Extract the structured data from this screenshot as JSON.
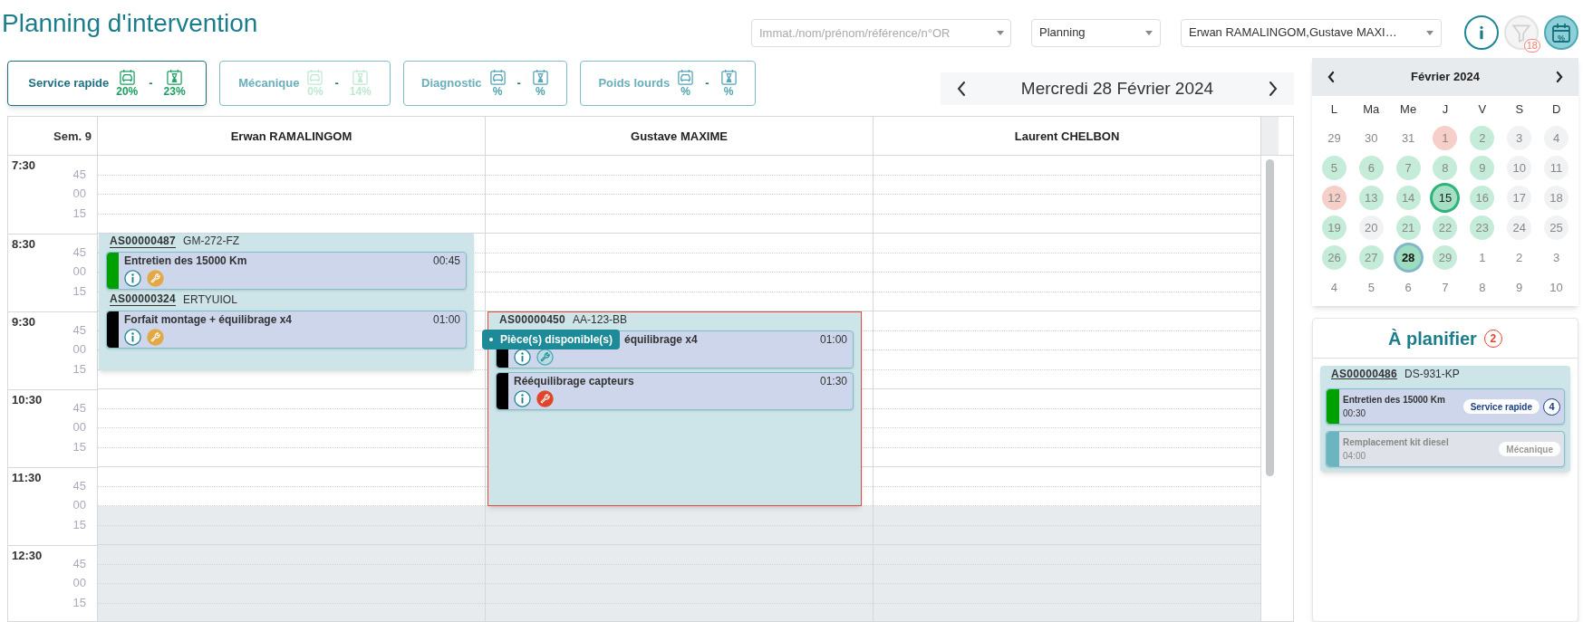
{
  "title": "Planning d'intervention",
  "toolbar": {
    "search": {
      "placeholder": "Immat./nom/prénom/référence/n°OR"
    },
    "view_select": {
      "value": "Planning"
    },
    "technicians_select": {
      "value": "Erwan RAMALINGOM,Gustave MAXI…"
    },
    "buttons": [
      {
        "kind": "info",
        "selected": false,
        "disabled": false
      },
      {
        "kind": "filter",
        "selected": false,
        "disabled": true,
        "badge": "18"
      },
      {
        "kind": "calendar",
        "selected": true,
        "disabled": false,
        "label": "%"
      }
    ]
  },
  "categories": [
    {
      "label": "Service rapide",
      "selected": true,
      "color": "#1aa060",
      "separator": "-",
      "stats": [
        "20%",
        "23%"
      ]
    },
    {
      "label": "Mécanique",
      "selected": false,
      "color": "#bfe8d2",
      "separator": "-",
      "stats": [
        "0%",
        "14%"
      ]
    },
    {
      "label": "Diagnostic",
      "selected": false,
      "color": "#4fa3b2",
      "separator": "-",
      "stats": [
        "%",
        "%"
      ]
    },
    {
      "label": "Poids lourds",
      "selected": false,
      "color": "#4fa3b2",
      "separator": "-",
      "stats": [
        "%",
        "%"
      ]
    }
  ],
  "date_nav": {
    "date": "Mercredi 28 Février 2024"
  },
  "planning": {
    "week_label": "Sem. 9",
    "rows": [
      {
        "label": "7:30",
        "kind": "hour",
        "closed": false
      },
      {
        "label": "45",
        "kind": "quarter",
        "closed": false
      },
      {
        "label": "00",
        "kind": "quarter",
        "closed": false
      },
      {
        "label": "15",
        "kind": "quarter",
        "closed": false
      },
      {
        "label": "8:30",
        "kind": "hour",
        "closed": false
      },
      {
        "label": "45",
        "kind": "quarter",
        "closed": false
      },
      {
        "label": "00",
        "kind": "quarter",
        "closed": false
      },
      {
        "label": "15",
        "kind": "quarter",
        "closed": false
      },
      {
        "label": "9:30",
        "kind": "hour",
        "closed": false
      },
      {
        "label": "45",
        "kind": "quarter",
        "closed": false
      },
      {
        "label": "00",
        "kind": "quarter",
        "closed": false
      },
      {
        "label": "15",
        "kind": "quarter",
        "closed": false
      },
      {
        "label": "10:30",
        "kind": "hour",
        "closed": false
      },
      {
        "label": "45",
        "kind": "quarter",
        "closed": false
      },
      {
        "label": "00",
        "kind": "quarter",
        "closed": false
      },
      {
        "label": "15",
        "kind": "quarter",
        "closed": false
      },
      {
        "label": "11:30",
        "kind": "hour",
        "closed": false
      },
      {
        "label": "45",
        "kind": "quarter",
        "closed": false
      },
      {
        "label": "00",
        "kind": "quarter",
        "closed": true
      },
      {
        "label": "15",
        "kind": "quarter",
        "closed": true
      },
      {
        "label": "12:30",
        "kind": "hour",
        "closed": true
      },
      {
        "label": "45",
        "kind": "quarter",
        "closed": true
      },
      {
        "label": "00",
        "kind": "quarter",
        "closed": true
      },
      {
        "label": "15",
        "kind": "quarter",
        "closed": true
      }
    ],
    "columns": [
      {
        "name": "Erwan RAMALINGOM",
        "timeline": [
          {
            "kind": "free"
          },
          {
            "kind": "free"
          },
          {
            "kind": "free"
          },
          {
            "kind": "free"
          },
          {
            "kind": "booking",
            "ref": "AS00000487",
            "underlined": true,
            "plate": "GM-272-FZ",
            "alert": false,
            "tasks": [
              {
                "title": "Entretien des 15000 Km",
                "duration": "00:45",
                "color": "#00a000",
                "parts_available": false,
                "parts_missing": false
              }
            ]
          },
          {
            "kind": "booking",
            "ref": "AS00000324",
            "underlined": true,
            "plate": "ERTYUIOL",
            "alert": false,
            "tasks": [
              {
                "title": "Forfait montage + équilibrage x4",
                "duration": "01:00",
                "color": "#000000",
                "parts_available": false,
                "parts_missing": false
              }
            ]
          }
        ]
      },
      {
        "name": "Gustave MAXIME",
        "timeline": [
          {
            "kind": "free"
          },
          {
            "kind": "free"
          },
          {
            "kind": "free"
          },
          {
            "kind": "free"
          },
          {
            "kind": "free"
          },
          {
            "kind": "free"
          },
          {
            "kind": "free"
          },
          {
            "kind": "free"
          },
          {
            "kind": "booking",
            "ref": "AS00000450",
            "underlined": false,
            "plate": "AA-123-BB",
            "alert": true,
            "tasks": [
              {
                "title": "équilibrage x4",
                "duration": "01:00",
                "color": "#000000",
                "parts_available": true,
                "parts_missing": false,
                "tooltip": "Pièce(s) disponible(s)"
              },
              {
                "title": "Rééquilibrage capteurs",
                "duration": "01:30",
                "color": "#000000",
                "parts_available": false,
                "parts_missing": true
              }
            ]
          }
        ]
      },
      {
        "name": "Laurent CHELBON"
      }
    ]
  },
  "mini_calendar": {
    "month": "Février 2024",
    "weekdays": [
      "L",
      "Ma",
      "Me",
      "J",
      "V",
      "S",
      "D"
    ],
    "days": [
      {
        "label": "29",
        "selected": false,
        "ringed": false
      },
      {
        "label": "30",
        "selected": false,
        "ringed": false
      },
      {
        "label": "31",
        "selected": false,
        "ringed": false
      },
      {
        "label": "1",
        "color": "#f6cfc9",
        "selected": false,
        "ringed": false
      },
      {
        "label": "2",
        "color": "#c5ecd9",
        "selected": false,
        "ringed": false
      },
      {
        "label": "3",
        "color": "#f1f2f4",
        "selected": false,
        "ringed": false
      },
      {
        "label": "4",
        "color": "#f1f2f4",
        "selected": false,
        "ringed": false
      },
      {
        "label": "5",
        "color": "#c5ecd9",
        "selected": false,
        "ringed": false
      },
      {
        "label": "6",
        "color": "#c5ecd9",
        "selected": false,
        "ringed": false
      },
      {
        "label": "7",
        "color": "#c5ecd9",
        "selected": false,
        "ringed": false
      },
      {
        "label": "8",
        "color": "#c5ecd9",
        "selected": false,
        "ringed": false
      },
      {
        "label": "9",
        "color": "#c5ecd9",
        "selected": false,
        "ringed": false
      },
      {
        "label": "10",
        "color": "#f1f2f4",
        "selected": false,
        "ringed": false
      },
      {
        "label": "11",
        "color": "#f1f2f4",
        "selected": false,
        "ringed": false
      },
      {
        "label": "12",
        "color": "#f6cfc9",
        "selected": false,
        "ringed": false
      },
      {
        "label": "13",
        "color": "#c5ecd9",
        "selected": false,
        "ringed": false
      },
      {
        "label": "14",
        "color": "#c5ecd9",
        "selected": false,
        "ringed": false
      },
      {
        "label": "15",
        "color": "#a6e0c4",
        "selected": false,
        "ringed": true
      },
      {
        "label": "16",
        "color": "#c5ecd9",
        "selected": false,
        "ringed": false
      },
      {
        "label": "17",
        "color": "#f1f2f4",
        "selected": false,
        "ringed": false
      },
      {
        "label": "18",
        "color": "#f1f2f4",
        "selected": false,
        "ringed": false
      },
      {
        "label": "19",
        "color": "#c5ecd9",
        "selected": false,
        "ringed": false
      },
      {
        "label": "20",
        "color": "#f1f2f4",
        "selected": false,
        "ringed": false
      },
      {
        "label": "21",
        "color": "#c5ecd9",
        "selected": false,
        "ringed": false
      },
      {
        "label": "22",
        "color": "#c5ecd9",
        "selected": false,
        "ringed": false
      },
      {
        "label": "23",
        "color": "#c5ecd9",
        "selected": false,
        "ringed": false
      },
      {
        "label": "24",
        "color": "#f1f2f4",
        "selected": false,
        "ringed": false
      },
      {
        "label": "25",
        "color": "#f1f2f4",
        "selected": false,
        "ringed": false
      },
      {
        "label": "26",
        "color": "#c5ecd9",
        "selected": false,
        "ringed": false
      },
      {
        "label": "27",
        "color": "#c5ecd9",
        "selected": false,
        "ringed": false
      },
      {
        "label": "28",
        "color": "#9edcbf",
        "selected": true,
        "ringed": false
      },
      {
        "label": "29",
        "color": "#c5ecd9",
        "selected": false,
        "ringed": false
      },
      {
        "label": "1",
        "selected": false,
        "ringed": false
      },
      {
        "label": "2",
        "selected": false,
        "ringed": false
      },
      {
        "label": "3",
        "selected": false,
        "ringed": false
      },
      {
        "label": "4",
        "selected": false,
        "ringed": false
      },
      {
        "label": "5",
        "selected": false,
        "ringed": false
      },
      {
        "label": "6",
        "selected": false,
        "ringed": false
      },
      {
        "label": "7",
        "selected": false,
        "ringed": false
      },
      {
        "label": "8",
        "selected": false,
        "ringed": false
      },
      {
        "label": "9",
        "selected": false,
        "ringed": false
      },
      {
        "label": "10",
        "selected": false,
        "ringed": false
      }
    ]
  },
  "to_plan": {
    "title": "À planifier",
    "count": "2",
    "groups": [
      {
        "ref": "AS00000486",
        "underlined": true,
        "plate": "DS-931-KP",
        "tasks": [
          {
            "title": "Entretien des 15000 Km",
            "duration": "00:30",
            "color": "#00a000",
            "category": "Service rapide",
            "count": "4",
            "disabled": false
          },
          {
            "title": "Remplacement kit diesel",
            "duration": "04:00",
            "color": "#6cb4c0",
            "category": "Mécanique",
            "disabled": true
          }
        ]
      }
    ]
  }
}
